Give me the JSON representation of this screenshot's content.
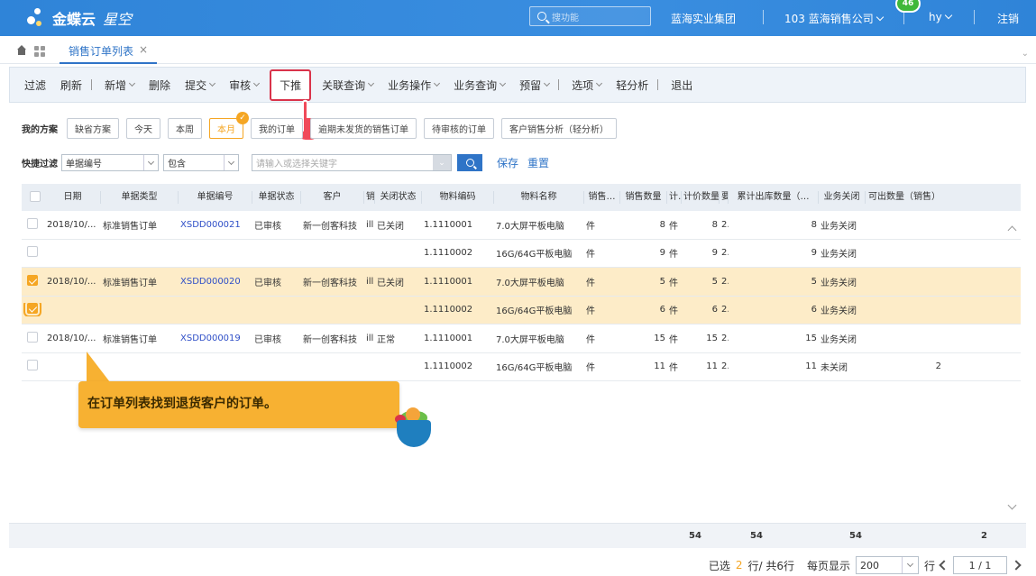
{
  "header": {
    "brand": "金蝶云",
    "brand_sub": "星空",
    "search_placeholder": "搜功能",
    "group": "蓝海实业集团",
    "org": "103 蓝海销售公司",
    "notification_count": "46",
    "user": "hy",
    "logout": "注销",
    "colors": {
      "bar": "#2f84d8",
      "accent": "#f5a623",
      "highlight": "#d9334a"
    }
  },
  "tabs": [
    {
      "label": "销售订单列表",
      "close": "×"
    }
  ],
  "toolbar": {
    "filter": "过滤",
    "refresh": "刷新",
    "new": "新增",
    "delete": "删除",
    "submit": "提交",
    "audit": "审核",
    "push_down": "下推",
    "linked_query": "关联查询",
    "business_ops": "业务操作",
    "business_query": "业务查询",
    "reserve": "预留",
    "options": "选项",
    "light_analysis": "轻分析",
    "exit": "退出"
  },
  "schemes": {
    "label": "我的方案",
    "items": [
      "缺省方案",
      "今天",
      "本周",
      "本月",
      "我的订单",
      "逾期未发货的销售订单",
      "待审核的订单",
      "客户销售分析（轻分析）"
    ],
    "active_index": 3
  },
  "quick_filter": {
    "label": "快捷过滤",
    "field": "单据编号",
    "operator": "包含",
    "placeholder": "请输入或选择关键字",
    "save": "保存",
    "reset": "重置"
  },
  "table": {
    "columns": [
      "日期",
      "单据类型",
      "单据编号",
      "单据状态",
      "客户",
      "销",
      "关闭状态",
      "物料编码",
      "物料名称",
      "销售…",
      "销售数量",
      "计…",
      "计价数量",
      "要…",
      "累计出库数量（…",
      "业务关闭",
      "可出数量（销售）"
    ],
    "rows": [
      {
        "checked": false,
        "date": "2018/10/...",
        "type": "标准销售订单",
        "no": "XSDD000021",
        "status": "已审核",
        "customer": "新一创客科技",
        "s": "ill",
        "close": "已关闭",
        "mat_code": "1.1110001",
        "mat_name": "7.0大屏平板电脑",
        "unit": "件",
        "qty": "8",
        "u2": "件",
        "price_qty": "8",
        "req": "2...",
        "out_qty": "8",
        "biz_close": "业务关闭",
        "avail": ""
      },
      {
        "checked": false,
        "date": "",
        "type": "",
        "no": "",
        "status": "",
        "customer": "",
        "s": "",
        "close": "",
        "mat_code": "1.1110002",
        "mat_name": "16G/64G平板电脑",
        "unit": "件",
        "qty": "9",
        "u2": "件",
        "price_qty": "9",
        "req": "2...",
        "out_qty": "9",
        "biz_close": "业务关闭",
        "avail": ""
      },
      {
        "checked": true,
        "date": "2018/10/...",
        "type": "标准销售订单",
        "no": "XSDD000020",
        "status": "已审核",
        "customer": "新一创客科技",
        "s": "ill",
        "close": "已关闭",
        "mat_code": "1.1110001",
        "mat_name": "7.0大屏平板电脑",
        "unit": "件",
        "qty": "5",
        "u2": "件",
        "price_qty": "5",
        "req": "2...",
        "out_qty": "5",
        "biz_close": "业务关闭",
        "avail": ""
      },
      {
        "checked": true,
        "date": "",
        "type": "",
        "no": "",
        "status": "",
        "customer": "",
        "s": "",
        "close": "",
        "mat_code": "1.1110002",
        "mat_name": "16G/64G平板电脑",
        "unit": "件",
        "qty": "6",
        "u2": "件",
        "price_qty": "6",
        "req": "2...",
        "out_qty": "6",
        "biz_close": "业务关闭",
        "avail": ""
      },
      {
        "checked": false,
        "date": "2018/10/...",
        "type": "标准销售订单",
        "no": "XSDD000019",
        "status": "已审核",
        "customer": "新一创客科技",
        "s": "ill",
        "close": "正常",
        "mat_code": "1.1110001",
        "mat_name": "7.0大屏平板电脑",
        "unit": "件",
        "qty": "15",
        "u2": "件",
        "price_qty": "15",
        "req": "2...",
        "out_qty": "15",
        "biz_close": "业务关闭",
        "avail": ""
      },
      {
        "checked": false,
        "date": "",
        "type": "",
        "no": "",
        "status": "",
        "customer": "",
        "s": "",
        "close": "",
        "mat_code": "1.1110002",
        "mat_name": "16G/64G平板电脑",
        "unit": "件",
        "qty": "11",
        "u2": "件",
        "price_qty": "11",
        "req": "2...",
        "out_qty": "11",
        "biz_close": "未关闭",
        "avail": "2"
      }
    ],
    "totals": {
      "qty": "54",
      "price_qty": "54",
      "out_qty": "54",
      "avail": "2"
    }
  },
  "pager": {
    "selected_prefix": "已选",
    "selected_count": "2",
    "selected_suffix": "行/ 共6行",
    "per_page_label": "每页显示",
    "per_page": "200",
    "rows_label": "行",
    "page": "1 / 1"
  },
  "tooltip": {
    "text": "在订单列表找到退货客户的订单。"
  }
}
